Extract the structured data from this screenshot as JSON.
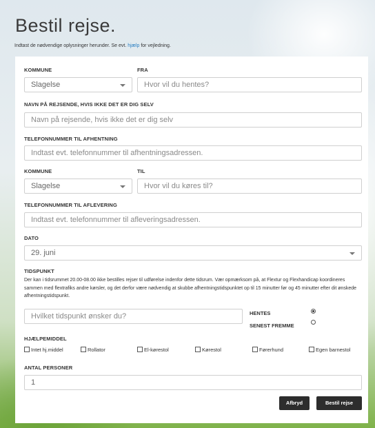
{
  "page": {
    "title": "Bestil rejse.",
    "intro_before": "Indtast de nødvendige oplysninger herunder. Se evt.",
    "intro_link": "hjælp",
    "intro_after": "for vejledning."
  },
  "form": {
    "kommune1": {
      "label": "KOMMUNE",
      "value": "Slagelse"
    },
    "fra": {
      "label": "FRA",
      "placeholder": "Hvor vil du hentes?"
    },
    "navn": {
      "label": "NAVN PÅ REJSENDE, HVIS IKKE DET ER DIG SELV",
      "placeholder": "Navn på rejsende, hvis ikke det er dig selv"
    },
    "tlf_afhentning": {
      "label": "TELEFONNUMMER TIL AFHENTNING",
      "placeholder": "Indtast evt. telefonnummer til afhentningsadressen."
    },
    "kommune2": {
      "label": "KOMMUNE",
      "value": "Slagelse"
    },
    "til": {
      "label": "TIL",
      "placeholder": "Hvor vil du køres til?"
    },
    "tlf_aflevering": {
      "label": "TELEFONNUMMER TIL AFLEVERING",
      "placeholder": "Indtast evt. telefonnummer til afleveringsadressen."
    },
    "dato": {
      "label": "DATO",
      "value": "29. juni"
    },
    "tidspunkt": {
      "label": "TIDSPUNKT",
      "notice": "Der kan i tidsrummet 20.00-08.00 ikke bestilles rejser til udførelse indenfor dette tidsrum. Vær opmærksom på, at Flextur og Flexhandicap koordineres sammen med flextrafiks andre kørsler, og det derfor være nødvendig at skubbe afhentningstidspunktet op til 15 minutter før og 45 minutter efter dit ønskede afhentningstidspunkt.",
      "placeholder": "Hvilket tidspunkt ønsker du?",
      "options": [
        {
          "label": "HENTES",
          "checked": true
        },
        {
          "label": "SENEST FREMME",
          "checked": false
        }
      ]
    },
    "hjaelpemiddel": {
      "label": "HJÆLPEMIDDEL",
      "options": [
        "Intet hj.middel",
        "Rollator",
        "El-kørestol",
        "Kørestol",
        "Førerhund",
        "Egen barnestol"
      ]
    },
    "antal": {
      "label": "ANTAL PERSONER",
      "value": "1"
    }
  },
  "actions": {
    "cancel": "Afbryd",
    "submit": "Bestil rejse"
  }
}
